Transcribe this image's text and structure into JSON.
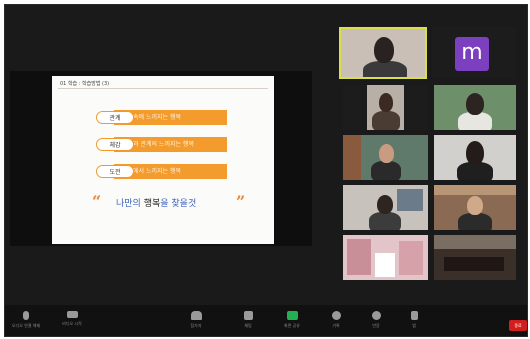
{
  "meeting": {
    "app": "Zoom",
    "view": "speaker-gallery"
  },
  "slide": {
    "header": "01 학습 : 학습방법 (3)",
    "items": [
      {
        "label": "관계",
        "text": "자연속에 느끼지는 행복"
      },
      {
        "label": "체감",
        "text": "자신과 관계의 느끼지는 행복"
      },
      {
        "label": "도전",
        "text": "미래에서 느끼지는 행복"
      }
    ],
    "tagline_part1": "나만의 ",
    "tagline_emph": "행복",
    "tagline_part2": "을 찾을것",
    "quote_open": "“",
    "quote_close": "”"
  },
  "participants": [
    {
      "name": "",
      "active_speaker": true
    },
    {
      "name": "",
      "avatar_letter": "m",
      "avatar_color": "#7b3fbf"
    },
    {
      "name": ""
    },
    {
      "name": ""
    },
    {
      "name": ""
    },
    {
      "name": ""
    },
    {
      "name": ""
    },
    {
      "name": ""
    },
    {
      "name": ""
    },
    {
      "name": ""
    }
  ],
  "toolbar": {
    "mute": "오디오 연결 해제",
    "video": "비디오 시작",
    "participants": "참가자",
    "chat": "채팅",
    "share": "화면 공유",
    "record": "기록",
    "reactions": "반응",
    "apps": "앱",
    "leave": "종료",
    "share_color": "#23b052",
    "leave_color": "#d11e1e"
  }
}
